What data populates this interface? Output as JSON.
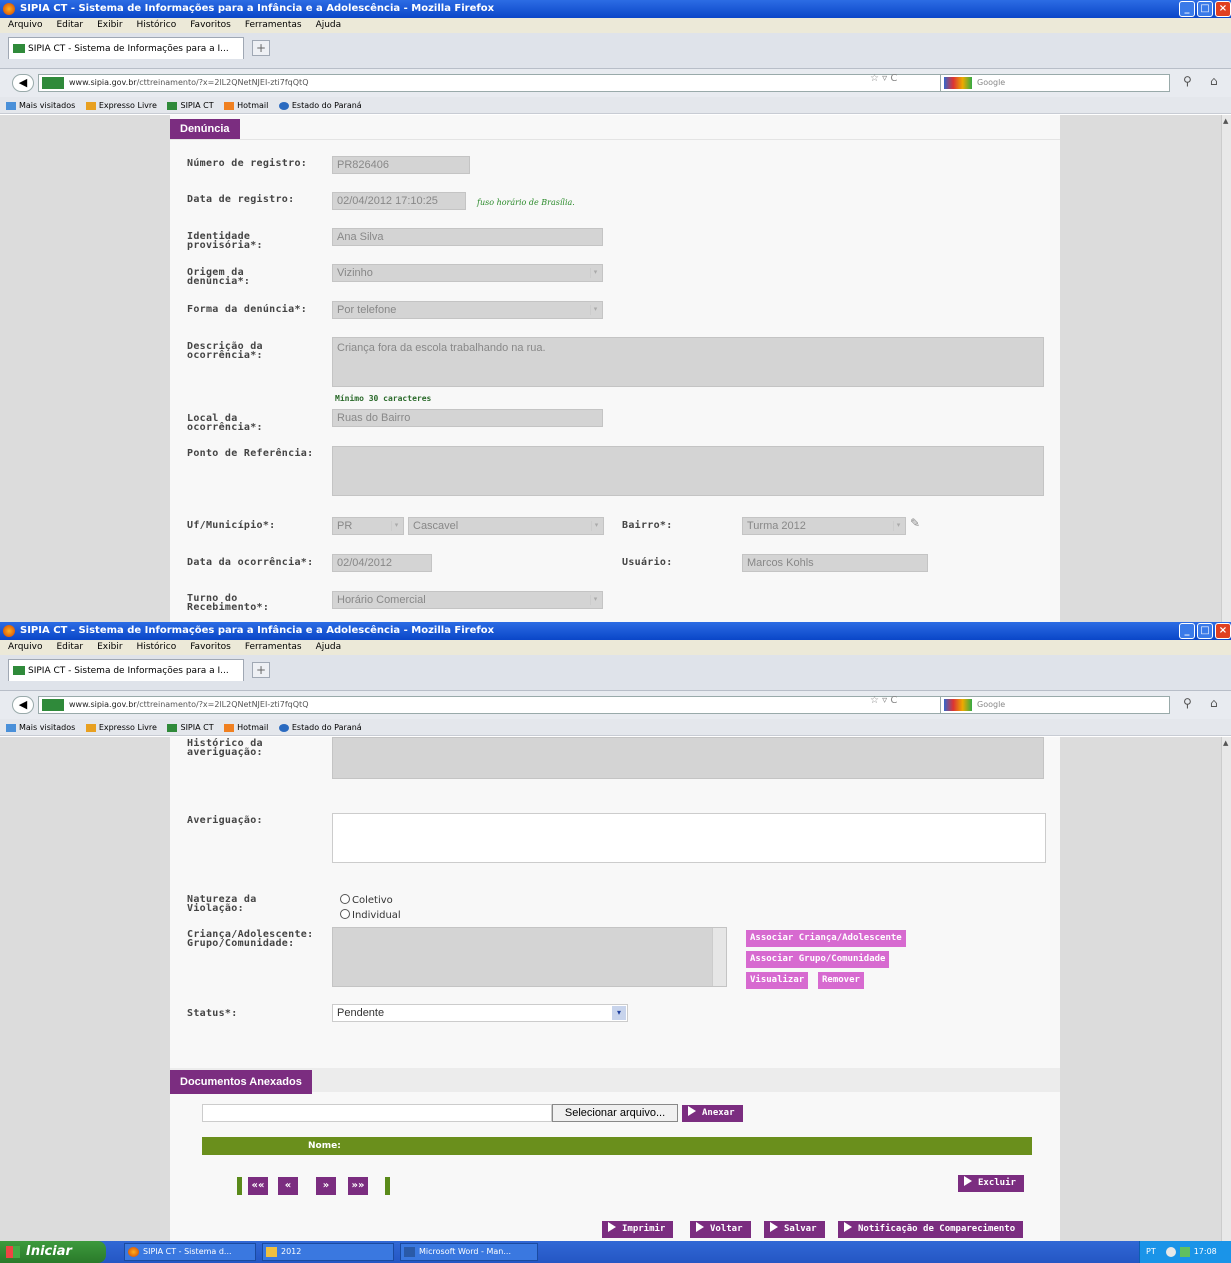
{
  "browser": {
    "window_title": "SIPIA CT - Sistema de Informações para a Infância e a Adolescência - Mozilla Firefox",
    "menu": [
      "Arquivo",
      "Editar",
      "Exibir",
      "Histórico",
      "Favoritos",
      "Ferramentas",
      "Ajuda"
    ],
    "tab_title": "SIPIA CT - Sistema de Informações para a I...",
    "url_site": "www.sipia.gov.br",
    "url_path": "/cttreinamento/?x=2lL2QNetNJEI-zti7fqQtQ",
    "search_placeholder": "Google",
    "bookmarks": [
      "Mais visitados",
      "Expresso Livre",
      "SIPIA CT",
      "Hotmail",
      "Estado do Paraná"
    ]
  },
  "denuncia": {
    "section_title": "Denúncia",
    "numero_label": "Número de registro:",
    "numero_value": "PR826406",
    "data_label": "Data de registro:",
    "data_value": "02/04/2012 17:10:25",
    "fuso_hint": "fuso horário de Brasília.",
    "identidade_label_1": "Identidade",
    "identidade_label_2": "provisória*:",
    "identidade_value": "Ana Silva",
    "origem_label_1": "Origem da",
    "origem_label_2": "denúncia*:",
    "origem_value": "Vizinho",
    "forma_label": "Forma da denúncia*:",
    "forma_value": "Por telefone",
    "descricao_label_1": "Descrição da",
    "descricao_label_2": "ocorrência*:",
    "descricao_value": "Criança fora da escola trabalhando na rua.",
    "min_hint": "Mínimo 30 caracteres",
    "local_label_1": "Local da",
    "local_label_2": "ocorrência*:",
    "local_value": "Ruas do Bairro",
    "ponto_label": "Ponto de Referência:",
    "ponto_value": "",
    "uf_label": "Uf/Município*:",
    "uf_value": "PR",
    "municipio_value": "Cascavel",
    "bairro_label": "Bairro*:",
    "bairro_value": "Turma 2012",
    "data_ocorrencia_label": "Data da ocorrência*:",
    "data_ocorrencia_value": "02/04/2012",
    "usuario_label": "Usuário:",
    "usuario_value": "Marcos Kohls",
    "turno_label_1": "Turno do",
    "turno_label_2": "Recebimento*:",
    "turno_value": "Horário Comercial"
  },
  "averiguacao": {
    "historico_label_1": "Histórico da",
    "historico_label_2": "averiguação:",
    "averiguacao_label": "Averiguação:",
    "natureza_label_1": "Natureza da",
    "natureza_label_2": "Violação:",
    "radio_coletivo": "Coletivo",
    "radio_individual": "Individual",
    "crianca_label_1": "Criança/Adolescente:",
    "crianca_label_2": "Grupo/Comunidade:",
    "btn_associar_crianca": "Associar Criança/Adolescente",
    "btn_associar_grupo": "Associar Grupo/Comunidade",
    "btn_visualizar": "Visualizar",
    "btn_remover": "Remover",
    "status_label": "Status*:",
    "status_value": "Pendente"
  },
  "documentos": {
    "section_title": "Documentos Anexados",
    "select_file_button": "Selecionar arquivo...",
    "anexar_button": "Anexar",
    "table_header_nome": "Nome:",
    "pager": [
      "««",
      "«",
      "»",
      "»»"
    ],
    "excluir_button": "Excluir"
  },
  "actions": {
    "imprimir": "Imprimir",
    "voltar": "Voltar",
    "salvar": "Salvar",
    "notificacao": "Notificação de Comparecimento"
  },
  "taskbar": {
    "start": "Iniciar",
    "tasks": [
      "SIPIA CT - Sistema d...",
      "2012",
      "Microsoft Word - Man..."
    ],
    "lang": "PT",
    "clock": "17:08"
  },
  "colors": {
    "accent_purple": "#7b2d80",
    "button_pink": "#d76ad0",
    "table_green": "#6a8f1c",
    "hint_green": "#2a8a2a"
  }
}
